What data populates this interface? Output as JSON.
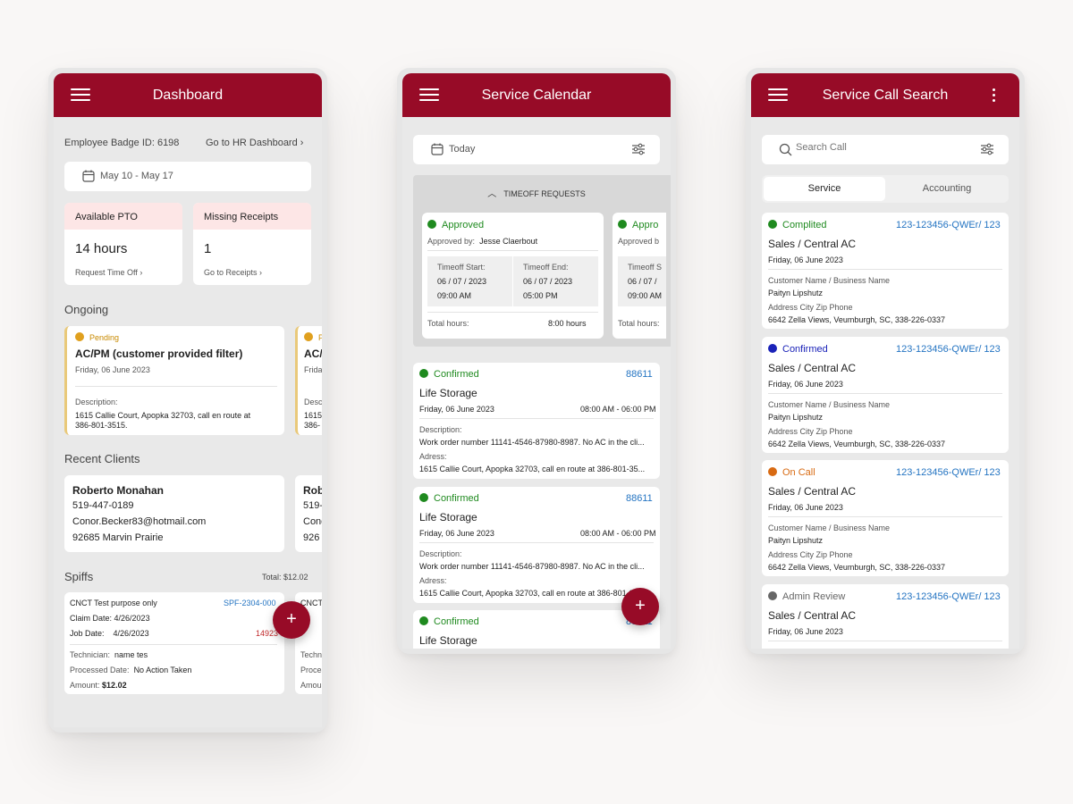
{
  "dashboard": {
    "title": "Dashboard",
    "badge_label": "Employee Badge ID: 6198",
    "hr_link": "Go to HR Dashboard",
    "chevron": "›",
    "date_range": "May 10 - May 17",
    "pto": {
      "title": "Available PTO",
      "value": "14 hours",
      "action": "Request Time Off"
    },
    "receipts": {
      "title": "Missing Receipts",
      "value": "1",
      "action": "Go to Receipts"
    },
    "ongoing_heading": "Ongoing",
    "ongoing": [
      {
        "status": "Pending",
        "title": "AC/PM (customer provided filter)",
        "date": "Friday, 06 June 2023",
        "desc_label": "Description:",
        "desc_line1": "1615 Callie Court, Apopka 32703, call en route at",
        "desc_line2": "386-801-3515."
      },
      {
        "status": "P",
        "title": "AC/",
        "date": "Frida",
        "desc_label": "Desc",
        "desc_line1": "1615",
        "desc_line2": "386-"
      }
    ],
    "recent_heading": "Recent Clients",
    "clients": [
      {
        "name": "Roberto Monahan",
        "phone": "519-447-0189",
        "email": "Conor.Becker83@hotmail.com",
        "address": "92685 Marvin Prairie"
      },
      {
        "name": "Rob",
        "phone": "519-",
        "email": "Conc",
        "address": "926"
      }
    ],
    "spiffs_heading": "Spiffs",
    "spiffs_total": "Total: $12.02",
    "spiffs": [
      {
        "title": "CNCT Test purpose only",
        "code": "SPF-2304-000",
        "claim_label": "Claim Date:",
        "claim_date": "4/26/2023",
        "job_label": "Job Date:",
        "job_date": "4/26/2023",
        "job_no": "14923",
        "tech_label": "Technician:",
        "tech": "name tes",
        "processed_label": "Processed Date:",
        "processed": "No Action Taken",
        "amount_label": "Amount:",
        "amount": "$12.02"
      },
      {
        "title": "CNCT",
        "tech_label": "Techn",
        "processed_label": "Proces",
        "amount_label": "Amou"
      }
    ],
    "fab": "+"
  },
  "calendar": {
    "title": "Service Calendar",
    "today": "Today",
    "timeoff_heading": "TIMEOFF REQUESTS",
    "timeoff": [
      {
        "status": "Approved",
        "approved_by_label": "Approved by:",
        "approved_by": "Jesse Claerbout",
        "start_label": "Timeoff Start:",
        "start_date": "06 / 07 / 2023",
        "start_time": "09:00 AM",
        "end_label": "Timeoff End:",
        "end_date": "06 / 07 / 2023",
        "end_time": "05:00 PM",
        "total_label": "Total hours:",
        "total": "8:00 hours"
      },
      {
        "status": "Appro",
        "approved_by_label": "Approved b",
        "start_label": "Timeoff S",
        "start_date": "06 / 07 /",
        "start_time": "09:00 AM",
        "total_label": "Total hours:"
      }
    ],
    "jobs": [
      {
        "status": "Confirmed",
        "id": "88611",
        "title": "Life Storage",
        "date": "Friday, 06 June 2023",
        "time": "08:00 AM - 06:00 PM",
        "desc_label": "Description:",
        "desc": "Work order number 11141-4546-87980-8987. No AC in the cli...",
        "addr_label": "Adress:",
        "addr": "1615 Callie Court, Apopka 32703, call en route at 386-801-35..."
      },
      {
        "status": "Confirmed",
        "id": "88611",
        "title": "Life Storage",
        "date": "Friday, 06 June 2023",
        "time": "08:00 AM - 06:00 PM",
        "desc_label": "Description:",
        "desc": "Work order number 11141-4546-87980-8987. No AC in the cli...",
        "addr_label": "Adress:",
        "addr": "1615 Callie Court, Apopka 32703, call en route at 386-801-35..."
      },
      {
        "status": "Confirmed",
        "id": "88611",
        "title": "Life Storage"
      }
    ],
    "fab": "+"
  },
  "search": {
    "title": "Service Call Search",
    "placeholder": "Search Call",
    "tabs": [
      "Service",
      "Accounting"
    ],
    "results": [
      {
        "status": "Complited",
        "color": "#1f8a1f",
        "id": "123-123456-QWEr/ 123",
        "title": "Sales / Central AC",
        "date": "Friday, 06 June 2023",
        "cust_label": "Customer Name / Business Name",
        "cust": "Paityn Lipshutz",
        "addr_label": "Address City Zip Phone",
        "addr": "6642 Zella Views, Veumburgh, SC, 338-226-0337"
      },
      {
        "status": "Confirmed",
        "color": "#1a22b8",
        "id": "123-123456-QWEr/ 123",
        "title": "Sales / Central AC",
        "date": "Friday, 06 June 2023",
        "cust_label": "Customer Name / Business Name",
        "cust": "Paityn Lipshutz",
        "addr_label": "Address City Zip Phone",
        "addr": "6642 Zella Views, Veumburgh, SC, 338-226-0337"
      },
      {
        "status": "On Call",
        "color": "#d86a12",
        "id": "123-123456-QWEr/ 123",
        "title": "Sales / Central AC",
        "date": "Friday, 06 June 2023",
        "cust_label": "Customer Name / Business Name",
        "cust": "Paityn Lipshutz",
        "addr_label": "Address City Zip Phone",
        "addr": "6642 Zella Views, Veumburgh, SC, 338-226-0337"
      },
      {
        "status": "Admin Review",
        "color": "#666666",
        "id": "123-123456-QWEr/ 123",
        "title": "Sales / Central AC",
        "date": "Friday, 06 June 2023"
      }
    ]
  },
  "colors": {
    "brand": "#970b27",
    "approved": "#1f8a1f",
    "pending": "#e0a01e",
    "link": "#2474c2",
    "danger": "#c0282a"
  }
}
